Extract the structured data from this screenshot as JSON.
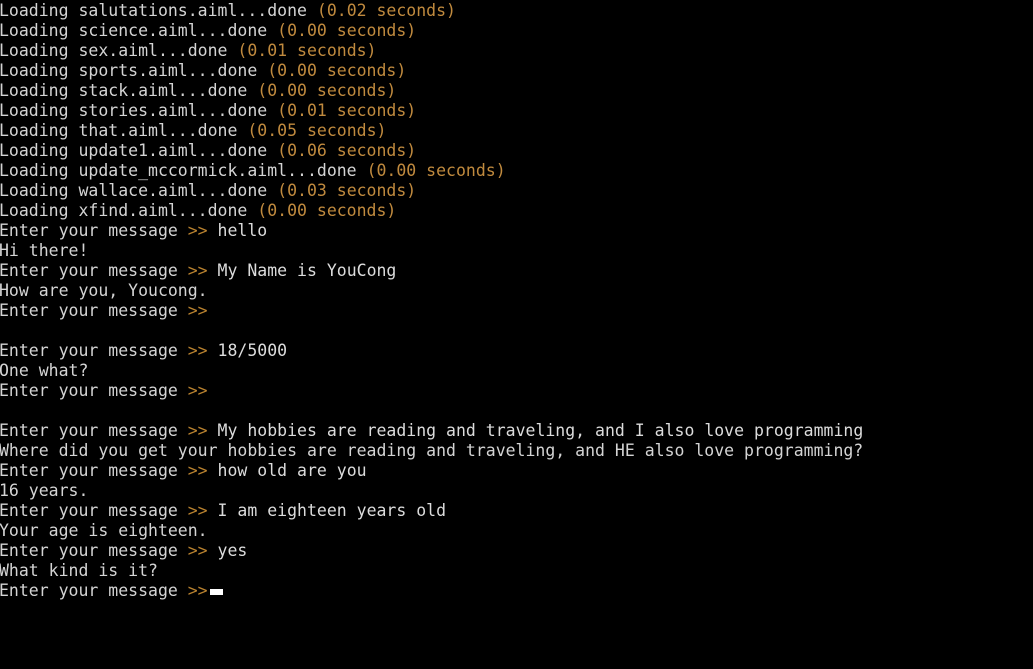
{
  "terminal": {
    "background_color": "#000000",
    "foreground_color": "#d4d4d4",
    "accent_color": "#b9822f",
    "cursor_color": "#ffffff",
    "prompt_label": "Enter your message ",
    "prompt_arrow": ">>",
    "loading_prefix": "Loading ",
    "loading_done": "...done"
  },
  "loading_lines": [
    {
      "file": "salutations.aiml",
      "time": "(0.02 seconds)"
    },
    {
      "file": "science.aiml",
      "time": "(0.00 seconds)"
    },
    {
      "file": "sex.aiml",
      "time": "(0.01 seconds)"
    },
    {
      "file": "sports.aiml",
      "time": "(0.00 seconds)"
    },
    {
      "file": "stack.aiml",
      "time": "(0.00 seconds)"
    },
    {
      "file": "stories.aiml",
      "time": "(0.01 seconds)"
    },
    {
      "file": "that.aiml",
      "time": "(0.05 seconds)"
    },
    {
      "file": "update1.aiml",
      "time": "(0.06 seconds)"
    },
    {
      "file": "update_mccormick.aiml",
      "time": "(0.00 seconds)"
    },
    {
      "file": "wallace.aiml",
      "time": "(0.03 seconds)"
    },
    {
      "file": "xfind.aiml",
      "time": "(0.00 seconds)"
    }
  ],
  "conversation": [
    {
      "input": "hello",
      "reply": "Hi there!",
      "blank_after": false
    },
    {
      "input": "My Name is YouCong",
      "reply": "How are you, Youcong.",
      "blank_after": false
    },
    {
      "input": "",
      "reply": "",
      "blank_after": true
    },
    {
      "input": "18/5000",
      "reply": "One what?",
      "blank_after": false
    },
    {
      "input": "",
      "reply": "",
      "blank_after": true
    },
    {
      "input": "My hobbies are reading and traveling, and I also love programming",
      "reply": "Where did you get your hobbies are reading and traveling, and HE also love programming?",
      "blank_after": false
    },
    {
      "input": "how old are you",
      "reply": "16 years.",
      "blank_after": false
    },
    {
      "input": "I am eighteen years old",
      "reply": "Your age is eighteen.",
      "blank_after": false
    },
    {
      "input": "yes",
      "reply": "What kind is it?",
      "blank_after": false
    }
  ],
  "final_prompt": {
    "label": "Enter your message ",
    "arrow": ">>",
    "cursor": "block"
  }
}
